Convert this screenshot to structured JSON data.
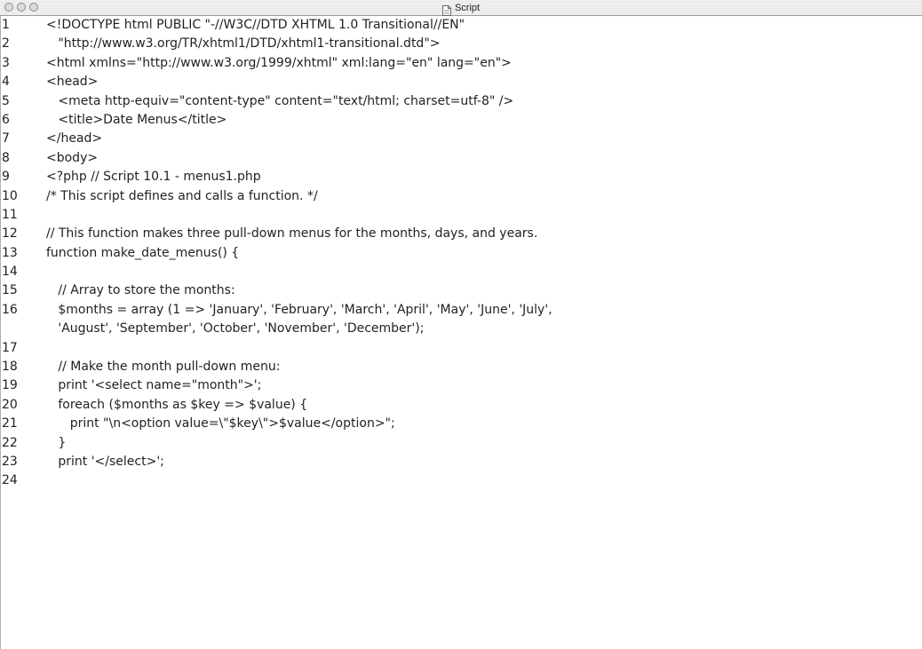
{
  "window": {
    "title": "Script"
  },
  "lines": [
    {
      "num": "1",
      "text": "<!DOCTYPE html PUBLIC \"-//W3C//DTD XHTML 1.0 Transitional//EN\""
    },
    {
      "num": "2",
      "text": "   \"http://www.w3.org/TR/xhtml1/DTD/xhtml1-transitional.dtd\">"
    },
    {
      "num": "3",
      "text": "<html xmlns=\"http://www.w3.org/1999/xhtml\" xml:lang=\"en\" lang=\"en\">"
    },
    {
      "num": "4",
      "text": "<head>"
    },
    {
      "num": "5",
      "text": "   <meta http-equiv=\"content-type\" content=\"text/html; charset=utf-8\" />"
    },
    {
      "num": "6",
      "text": "   <title>Date Menus</title>"
    },
    {
      "num": "7",
      "text": "</head>"
    },
    {
      "num": "8",
      "text": "<body>"
    },
    {
      "num": "9",
      "text": "<?php // Script 10.1 - menus1.php"
    },
    {
      "num": "10",
      "text": "/* This script defines and calls a function. */"
    },
    {
      "num": "11",
      "text": ""
    },
    {
      "num": "12",
      "text": "// This function makes three pull-down menus for the months, days, and years."
    },
    {
      "num": "13",
      "text": "function make_date_menus() {"
    },
    {
      "num": "14",
      "text": ""
    },
    {
      "num": "15",
      "text": "   // Array to store the months:"
    },
    {
      "num": "16",
      "text": "   $months = array (1 => 'January', 'February', 'March', 'April', 'May', 'June', 'July',\n   'August', 'September', 'October', 'November', 'December');"
    },
    {
      "num": "17",
      "text": ""
    },
    {
      "num": "18",
      "text": "   // Make the month pull-down menu:"
    },
    {
      "num": "19",
      "text": "   print '<select name=\"month\">';"
    },
    {
      "num": "20",
      "text": "   foreach ($months as $key => $value) {"
    },
    {
      "num": "21",
      "text": "      print \"\\n<option value=\\\"$key\\\">$value</option>\";"
    },
    {
      "num": "22",
      "text": "   }"
    },
    {
      "num": "23",
      "text": "   print '</select>';"
    },
    {
      "num": "24",
      "text": ""
    }
  ]
}
